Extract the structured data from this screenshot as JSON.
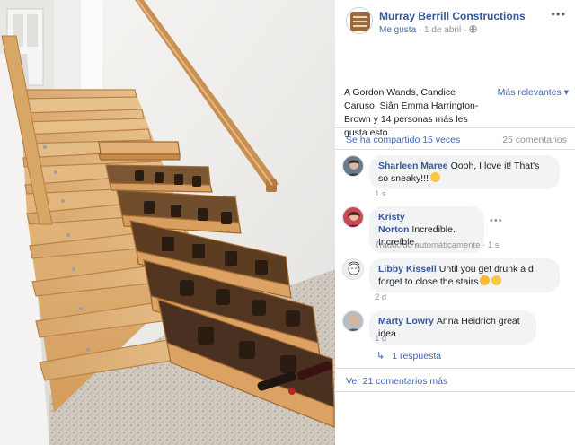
{
  "post": {
    "page_name": "Murray Berrill Constructions",
    "like_label": "Me gusta",
    "date": "1 de abril",
    "separator": "·",
    "privacy_icon": "globe-icon",
    "more_icon": "more-icon"
  },
  "reactions": {
    "text": "A Gordon Wands, Candice Caruso, Siân Emma Harrington-Brown y 14 personas más les gusta esto.",
    "sort_label": "Más relevantes ▾"
  },
  "stats": {
    "shares": "Se ha compartido 15 veces",
    "comments": "25 comentarios"
  },
  "comments": [
    {
      "author": "Sharleen Maree",
      "text": "Oooh, I love it! That's so sneaky!!!",
      "emoji": "grin-emoji",
      "time": "1 s",
      "translated": ""
    },
    {
      "author": "Kristy Norton",
      "text": "Incredible. Increíble.",
      "emoji": "",
      "time": "1 s",
      "translated": "Traducido automáticamente"
    },
    {
      "author": "Libby Kissell",
      "text": "Until you get drunk a d forget to close the stairs",
      "emoji": "drunk-emoji",
      "time": "2 d",
      "translated": ""
    },
    {
      "author": "Marty Lowry",
      "text": "Anna Heidrich great idea",
      "emoji": "",
      "time": "1 d",
      "translated": ""
    }
  ],
  "replies_label": "1 respuesta",
  "more_comments_label": "Ver 21 comentarios más",
  "colors": {
    "link": "#385898",
    "accent": "#4267b2",
    "meta": "#90949c",
    "bubble": "#f2f3f5"
  }
}
